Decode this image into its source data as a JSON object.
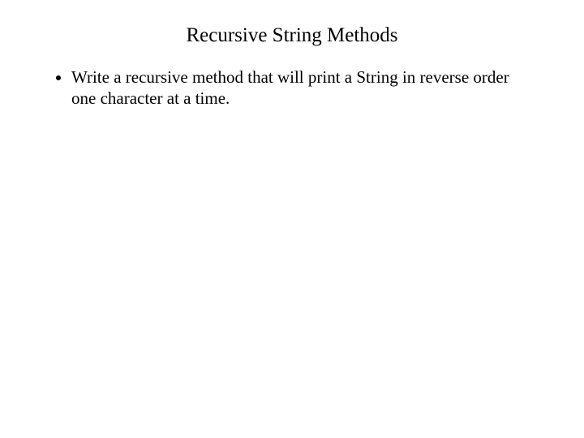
{
  "slide": {
    "title": "Recursive String Methods",
    "bullets": [
      "Write a recursive method that will print a String in reverse order one character at a time."
    ]
  }
}
